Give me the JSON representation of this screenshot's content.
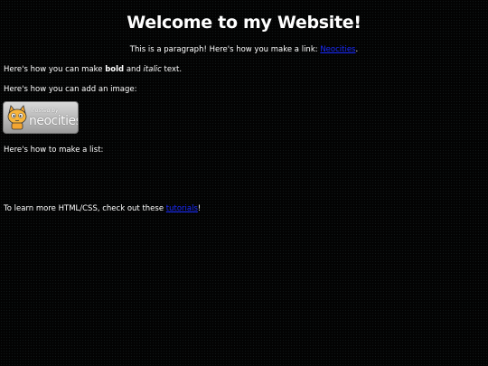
{
  "header": {
    "title": "Welcome to my Website!"
  },
  "intro": {
    "text": "This is a paragraph! Here's how you make a link: ",
    "link": "Neocities",
    "suffix": "."
  },
  "formatting": {
    "prefix": "Here's how you can make ",
    "bold": "bold",
    "middle": " and ",
    "italic": "italic",
    "suffix": " text."
  },
  "image_section": {
    "text": "Here's how you can add an image:",
    "badge_small": "hosted by",
    "badge_brand": "neocities"
  },
  "list_section": {
    "text": "Here's how to make a list:"
  },
  "footer": {
    "prefix": "To learn more HTML/CSS, check out these ",
    "link": "tutorials",
    "suffix": "!"
  },
  "colors": {
    "background": "#030303",
    "text": "#ffffff",
    "link": "#1a2bff"
  }
}
